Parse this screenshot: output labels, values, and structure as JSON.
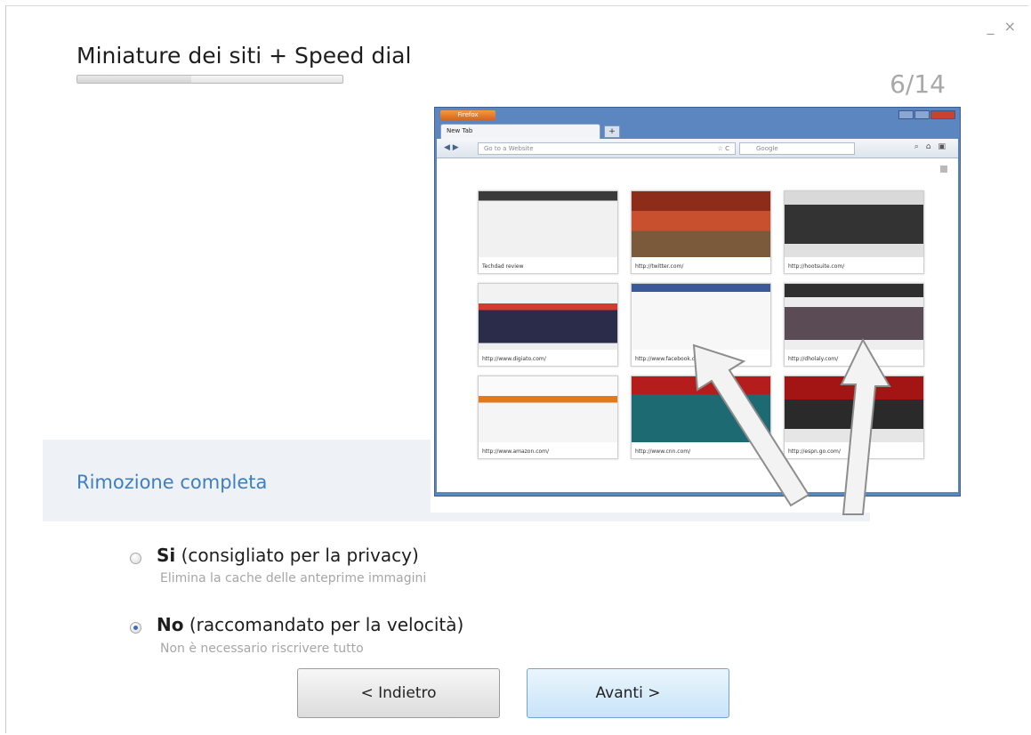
{
  "window": {
    "controls": {
      "minimize": "_",
      "close": "×"
    }
  },
  "header": {
    "title": "Miniature dei siti + Speed dial",
    "step": "6/14",
    "progress": 0.43
  },
  "section": {
    "title": "Rimozione completa"
  },
  "preview": {
    "menu_button": "Firefox",
    "tab_label": "New Tab",
    "new_tab": "+",
    "url_placeholder": "Go to a Website",
    "search_placeholder": "Google",
    "thumbnails": [
      {
        "caption": "Techdad review"
      },
      {
        "caption": "http://twitter.com/"
      },
      {
        "caption": "http://hootsuite.com/"
      },
      {
        "caption": "http://www.digiato.com/"
      },
      {
        "caption": "http://www.facebook.com/home.p..."
      },
      {
        "caption": "http://dholaly.com/"
      },
      {
        "caption": "http://www.amazon.com/"
      },
      {
        "caption": "http://www.cnn.com/"
      },
      {
        "caption": "http://espn.go.com/"
      }
    ]
  },
  "options": {
    "yes": {
      "bold": "Si",
      "label": " (consigliato per la privacy)",
      "sub": "Elimina la cache delle anteprime immagini",
      "selected": false
    },
    "no": {
      "bold": "No",
      "label": " (raccomandato per la velocità)",
      "sub": "Non è necessario riscrivere tutto",
      "selected": true
    }
  },
  "buttons": {
    "back": "< Indietro",
    "next": "Avanti >"
  }
}
